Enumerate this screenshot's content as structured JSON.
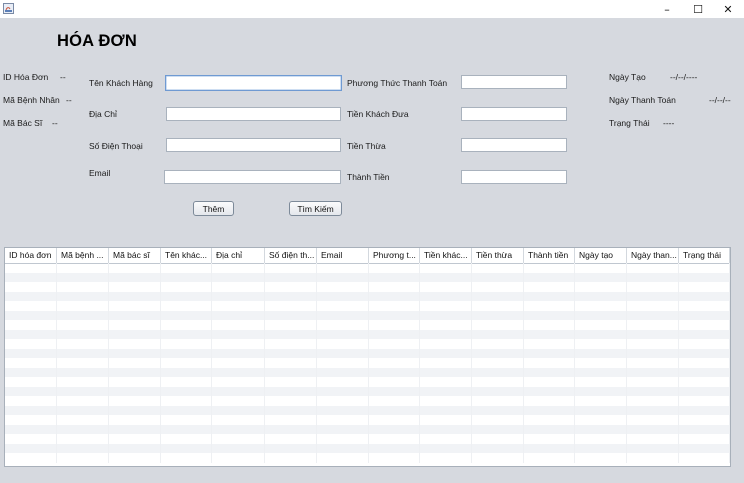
{
  "window": {
    "minimize": "–",
    "maximize": "☐",
    "close": "✕"
  },
  "header": {
    "title": "HÓA ĐƠN"
  },
  "left_info": [
    {
      "label": "ID Hóa Đơn",
      "value": "--"
    },
    {
      "label": "Mã Bệnh Nhân",
      "value": "--"
    },
    {
      "label": "Mã Bác Sĩ",
      "value": "--"
    }
  ],
  "form": {
    "ten_khach_hang": {
      "label": "Tên Khách Hàng",
      "value": ""
    },
    "dia_chi": {
      "label": "Địa Chỉ",
      "value": ""
    },
    "so_dien_thoai": {
      "label": "Số Điện Thoại",
      "value": ""
    },
    "email": {
      "label": "Email",
      "value": ""
    },
    "phuong_thuc": {
      "label": "Phương Thức Thanh Toán",
      "value": ""
    },
    "tien_khach_dua": {
      "label": "Tiền Khách Đưa",
      "value": ""
    },
    "tien_thua": {
      "label": "Tiền Thừa",
      "value": ""
    },
    "thanh_tien": {
      "label": "Thành Tiền",
      "value": ""
    }
  },
  "right_info": {
    "ngay_tao": {
      "label": "Ngày Tạo",
      "value": "--/--/----"
    },
    "ngay_thanh_toan": {
      "label": "Ngày Thanh Toán",
      "value": "--/--/--"
    },
    "trang_thai": {
      "label": "Trạng Thái",
      "value": "----"
    }
  },
  "buttons": {
    "them": "Thêm",
    "tim_kiem": "Tìm Kiếm"
  },
  "table": {
    "columns": [
      "ID hóa đơn",
      "Mã bệnh ...",
      "Mã bác sĩ",
      "Tên khác...",
      "Địa chỉ",
      "Số điện th...",
      "Email",
      "Phương t...",
      "Tiền khác...",
      "Tiền thừa",
      "Thành tiền",
      "Ngày tạo",
      "Ngày than...",
      "Trạng thái"
    ],
    "rows": []
  }
}
